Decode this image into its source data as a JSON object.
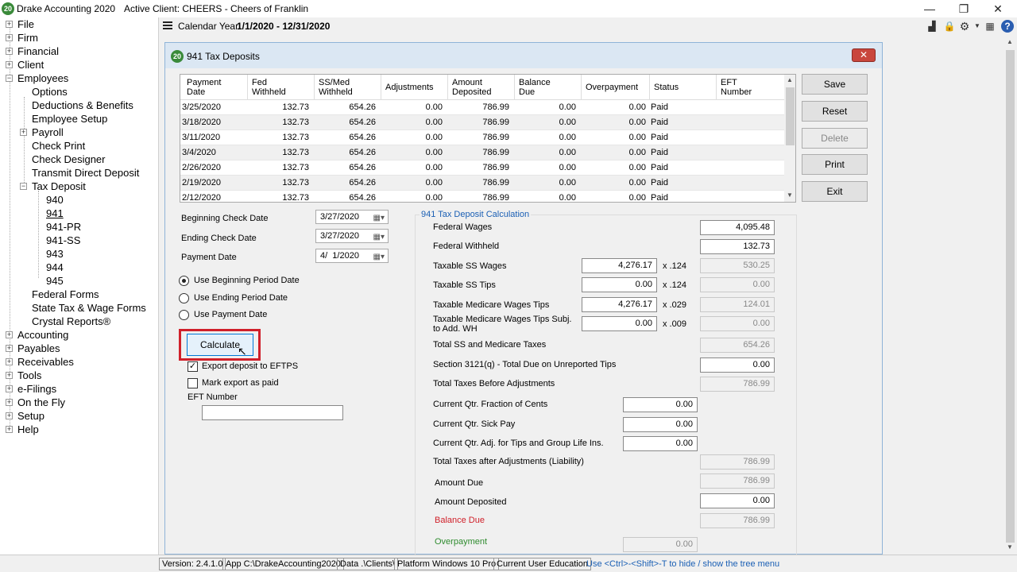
{
  "app": {
    "title": "Drake Accounting 2020",
    "logo": "20",
    "client_label": "Active Client: CHEERS - Cheers of Franklin"
  },
  "toolbar": {
    "calendar_label": "Calendar Year",
    "calendar_range": "1/1/2020 - 12/31/2020"
  },
  "tree": {
    "items": [
      {
        "label": "File"
      },
      {
        "label": "Firm"
      },
      {
        "label": "Financial"
      },
      {
        "label": "Client"
      },
      {
        "label": "Employees"
      },
      {
        "label": "Options"
      },
      {
        "label": "Deductions & Benefits"
      },
      {
        "label": "Employee Setup"
      },
      {
        "label": "Payroll"
      },
      {
        "label": "Check Print"
      },
      {
        "label": "Check Designer"
      },
      {
        "label": "Transmit Direct Deposit"
      },
      {
        "label": "Tax Deposit"
      },
      {
        "label": "940"
      },
      {
        "label": "941"
      },
      {
        "label": "941-PR"
      },
      {
        "label": "941-SS"
      },
      {
        "label": "943"
      },
      {
        "label": "944"
      },
      {
        "label": "945"
      },
      {
        "label": "Federal Forms"
      },
      {
        "label": "State Tax & Wage Forms"
      },
      {
        "label": "Crystal Reports®"
      },
      {
        "label": "Accounting"
      },
      {
        "label": "Payables"
      },
      {
        "label": "Receivables"
      },
      {
        "label": "Tools"
      },
      {
        "label": "e-Filings"
      },
      {
        "label": "On the Fly"
      },
      {
        "label": "Setup"
      },
      {
        "label": "Help"
      }
    ]
  },
  "dialog": {
    "logo": "20",
    "title": "941 Tax Deposits",
    "columns": [
      "Payment\nDate",
      "Fed\nWithheld",
      "SS/Med\nWithheld",
      "Adjustments",
      "Amount\nDeposited",
      "Balance\nDue",
      "Overpayment",
      "Status",
      "EFT\nNumber"
    ],
    "rows": [
      {
        "date": "3/25/2020",
        "fed": "132.73",
        "ssmed": "654.26",
        "adj": "0.00",
        "dep": "786.99",
        "bal": "0.00",
        "over": "0.00",
        "status": "Paid"
      },
      {
        "date": "3/18/2020",
        "fed": "132.73",
        "ssmed": "654.26",
        "adj": "0.00",
        "dep": "786.99",
        "bal": "0.00",
        "over": "0.00",
        "status": "Paid"
      },
      {
        "date": "3/11/2020",
        "fed": "132.73",
        "ssmed": "654.26",
        "adj": "0.00",
        "dep": "786.99",
        "bal": "0.00",
        "over": "0.00",
        "status": "Paid"
      },
      {
        "date": "3/4/2020",
        "fed": "132.73",
        "ssmed": "654.26",
        "adj": "0.00",
        "dep": "786.99",
        "bal": "0.00",
        "over": "0.00",
        "status": "Paid"
      },
      {
        "date": "2/26/2020",
        "fed": "132.73",
        "ssmed": "654.26",
        "adj": "0.00",
        "dep": "786.99",
        "bal": "0.00",
        "over": "0.00",
        "status": "Paid"
      },
      {
        "date": "2/19/2020",
        "fed": "132.73",
        "ssmed": "654.26",
        "adj": "0.00",
        "dep": "786.99",
        "bal": "0.00",
        "over": "0.00",
        "status": "Paid"
      },
      {
        "date": "2/12/2020",
        "fed": "132.73",
        "ssmed": "654.26",
        "adj": "0.00",
        "dep": "786.99",
        "bal": "0.00",
        "over": "0.00",
        "status": "Paid"
      }
    ],
    "buttons": {
      "save": "Save",
      "reset": "Reset",
      "delete": "Delete",
      "print": "Print",
      "exit": "Exit"
    },
    "dates": {
      "begin_label": "Beginning Check Date",
      "begin_value": "3/27/2020",
      "end_label": "Ending Check Date",
      "end_value": "3/27/2020",
      "pay_label": "Payment Date",
      "pay_value": "4/  1/2020"
    },
    "radios": {
      "begin": "Use Beginning Period Date",
      "end": "Use Ending Period Date",
      "pay": "Use Payment Date",
      "selected": "begin"
    },
    "calculate": "Calculate",
    "export_label": "Export deposit to EFTPS",
    "mark_label": "Mark export as paid",
    "eft_label": "EFT Number",
    "eft_value": "",
    "calc": {
      "group_title": "941 Tax Deposit Calculation",
      "federal_wages_label": "Federal Wages",
      "federal_wages": "4,095.48",
      "federal_withheld_label": "Federal Withheld",
      "federal_withheld": "132.73",
      "ss_wages_label": "Taxable SS Wages",
      "ss_wages": "4,276.17",
      "ss_rate": "x .124",
      "ss_result": "530.25",
      "ss_tips_label": "Taxable SS Tips",
      "ss_tips": "0.00",
      "ss_tips_rate": "x .124",
      "ss_tips_result": "0.00",
      "med_label": "Taxable Medicare Wages Tips",
      "med": "4,276.17",
      "med_rate": "x .029",
      "med_result": "124.01",
      "med_add_label_1": "Taxable Medicare Wages Tips Subj.",
      "med_add_label_2": "to Add. WH",
      "med_add": "0.00",
      "med_add_rate": "x .009",
      "med_add_result": "0.00",
      "total_ss_label": "Total SS and Medicare Taxes",
      "total_ss": "654.26",
      "sec3121_label": "Section 3121(q) - Total Due on Unreported Tips",
      "sec3121": "0.00",
      "before_adj_label": "Total Taxes Before Adjustments",
      "before_adj": "786.99",
      "fraction_label": "Current Qtr. Fraction of Cents",
      "fraction": "0.00",
      "sick_label": "Current Qtr. Sick Pay",
      "sick": "0.00",
      "tips_life_label": "Current Qtr. Adj. for Tips and Group Life Ins.",
      "tips_life": "0.00",
      "after_adj_label": "Total Taxes after Adjustments (Liability)",
      "after_adj": "786.99",
      "amount_due_label": "Amount Due",
      "amount_due": "786.99",
      "amount_dep_label": "Amount Deposited",
      "amount_dep": "0.00",
      "balance_label": "Balance Due",
      "balance": "786.99",
      "overpay_label": "Overpayment",
      "overpay": "0.00"
    }
  },
  "statusbar": {
    "version": "Version: 2.4.1.0",
    "app": "App C:\\DrakeAccounting2020",
    "data": "Data .\\Clients\\",
    "platform": "Platform Windows 10 Pro",
    "user": "Current User Education",
    "hint": "Use <Ctrl>-<Shift>-T to hide / show the tree menu"
  },
  "colors": {
    "balance_due": "#d0202a",
    "overpayment": "#2e8b2e",
    "link": "#1a5fb4",
    "highlight": "#d0202a"
  }
}
